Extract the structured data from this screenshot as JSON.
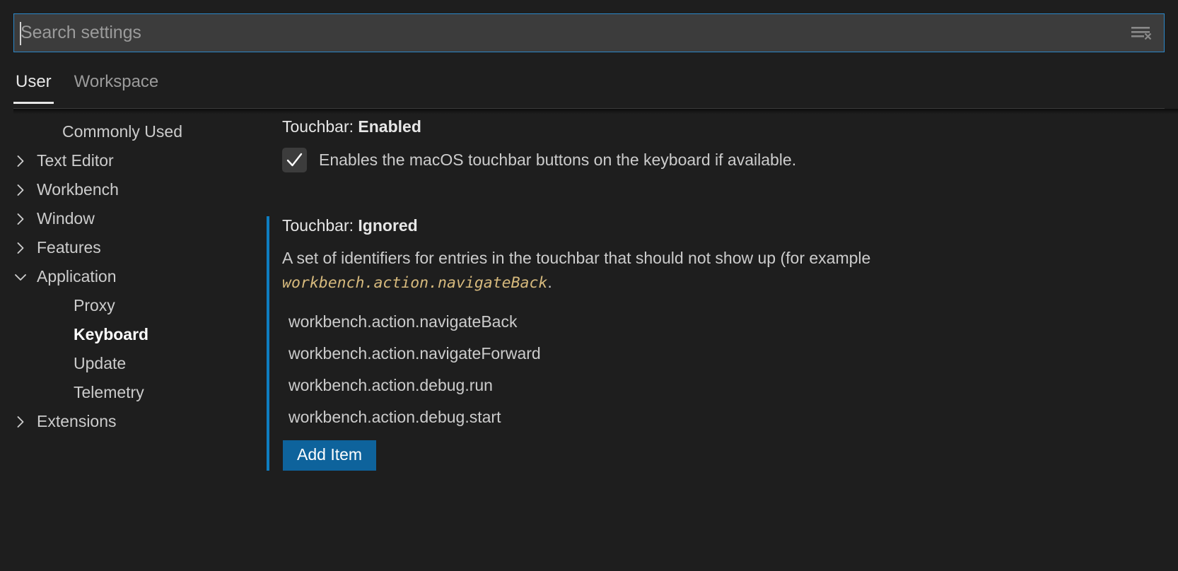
{
  "search": {
    "placeholder": "Search settings",
    "value": "",
    "clear_filters_icon": "clear-filters-icon"
  },
  "tabs": [
    {
      "label": "User",
      "active": true
    },
    {
      "label": "Workspace",
      "active": false
    }
  ],
  "toc": {
    "items": [
      {
        "label": "Commonly Used",
        "twisty": "none",
        "level": 0,
        "selected": false
      },
      {
        "label": "Text Editor",
        "twisty": "collapsed",
        "level": 0,
        "selected": false
      },
      {
        "label": "Workbench",
        "twisty": "collapsed",
        "level": 0,
        "selected": false
      },
      {
        "label": "Window",
        "twisty": "collapsed",
        "level": 0,
        "selected": false
      },
      {
        "label": "Features",
        "twisty": "collapsed",
        "level": 0,
        "selected": false
      },
      {
        "label": "Application",
        "twisty": "expanded",
        "level": 0,
        "selected": false
      },
      {
        "label": "Proxy",
        "twisty": "none",
        "level": 1,
        "selected": false
      },
      {
        "label": "Keyboard",
        "twisty": "none",
        "level": 1,
        "selected": true
      },
      {
        "label": "Update",
        "twisty": "none",
        "level": 1,
        "selected": false
      },
      {
        "label": "Telemetry",
        "twisty": "none",
        "level": 1,
        "selected": false
      },
      {
        "label": "Extensions",
        "twisty": "collapsed",
        "level": 0,
        "selected": false
      }
    ]
  },
  "settings": [
    {
      "category": "Touchbar: ",
      "key": "Enabled",
      "type": "checkbox",
      "checked": true,
      "checkbox_description": "Enables the macOS touchbar buttons on the keyboard if available.",
      "focused": false
    },
    {
      "category": "Touchbar: ",
      "key": "Ignored",
      "type": "list",
      "focused": true,
      "description_before": "A set of identifiers for entries in the touchbar that should not show up (for example ",
      "description_code": "workbench.action.navigateBack",
      "description_after": ".",
      "items": [
        "workbench.action.navigateBack",
        "workbench.action.navigateForward",
        "workbench.action.debug.run",
        "workbench.action.debug.start"
      ],
      "add_item_label": "Add Item"
    }
  ],
  "colors": {
    "background": "#1e1e1e",
    "input_background": "#3c3c3c",
    "focus_border": "#2b87c8",
    "accent_bar": "#0e7dc1",
    "button_background": "#0e639c",
    "code_text": "#d7ba7d",
    "foreground": "#cccccc"
  }
}
